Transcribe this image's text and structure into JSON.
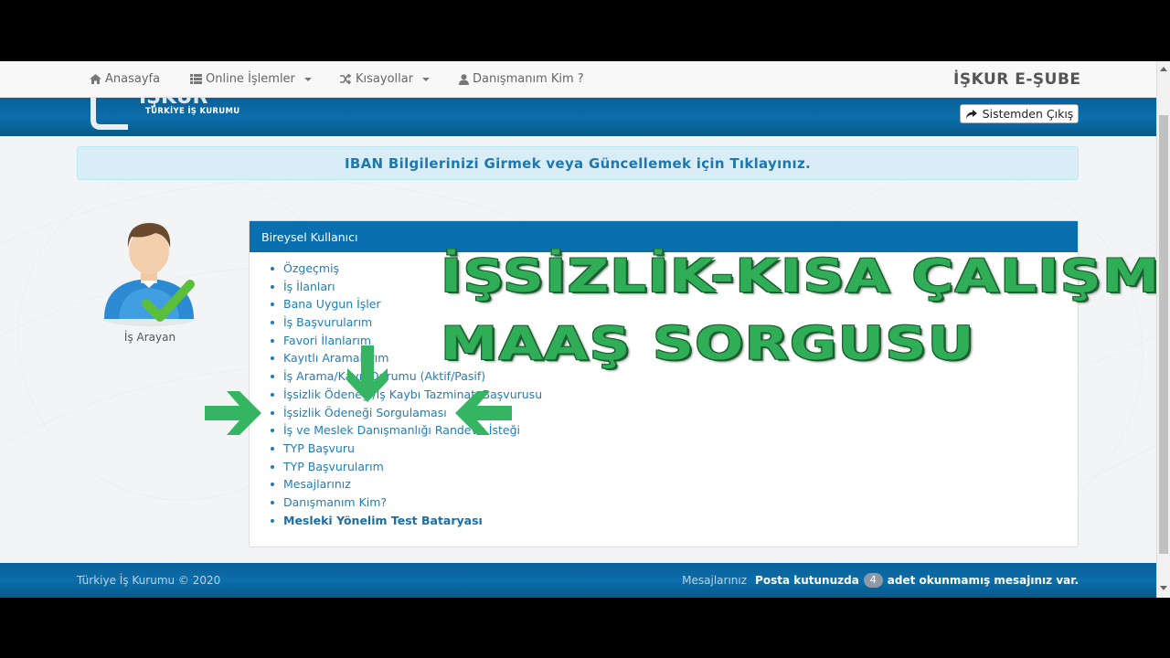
{
  "navbar": {
    "items": [
      {
        "label": "Anasayfa",
        "icon": "home-icon"
      },
      {
        "label": "Online İşlemler",
        "icon": "list-icon",
        "dropdown": true
      },
      {
        "label": "Kısayollar",
        "icon": "shuffle-icon",
        "dropdown": true
      },
      {
        "label": "Danışmanım Kim ?",
        "icon": "user-icon"
      }
    ],
    "brand": "İŞKUR E-ŞUBE"
  },
  "header": {
    "logo_text": "İŞKUR",
    "logo_subtitle": "TÜRKİYE İŞ KURUMU",
    "logout_label": "Sistemden Çıkış",
    "logout_icon": "share-icon"
  },
  "iban_banner": "IBAN Bilgilerinizi Girmek veya Güncellemek için Tıklayınız.",
  "profile": {
    "role": "İş Arayan",
    "avatar_icon": "user-avatar-checkmark-icon"
  },
  "panel": {
    "title": "Bireysel Kullanıcı",
    "items": [
      "Özgeçmiş",
      "İş İlanları",
      "Bana Uygun İşler",
      "İş Başvurularım",
      "Favori İlanlarım",
      "Kayıtlı Aramalarım",
      "İş Arama/Kayıt Durumu (Aktif/Pasif)",
      "İşsizlik Ödeneği/İş Kaybı Tazminatı Başvurusu",
      "İşsizlik Ödeneği Sorgulaması",
      "İş ve Meslek Danışmanlığı Randevu İsteği",
      "TYP Başvuru",
      "TYP Başvurularım",
      "Mesajlarınız",
      "Danışmanım Kim?",
      "Mesleki Yönelim Test Bataryası"
    ]
  },
  "overlay": {
    "line1": "İŞSİZLİK-KISA ÇALIŞMA",
    "line2": "MAAŞ SORGUSU"
  },
  "footer": {
    "copyright": "Türkiye İş Kurumu © 2020",
    "messages_link": "Mesajlarınız",
    "inbox_prefix": "Posta kutunuzda",
    "unread_count": "4",
    "inbox_suffix": "adet okunmamış mesajınız var."
  },
  "colors": {
    "primary": "#0a6fae",
    "link": "#1f7cb8",
    "overlay_green": "#2fae57",
    "arrow_green": "#35b561",
    "info_bg": "#d9edf7"
  }
}
